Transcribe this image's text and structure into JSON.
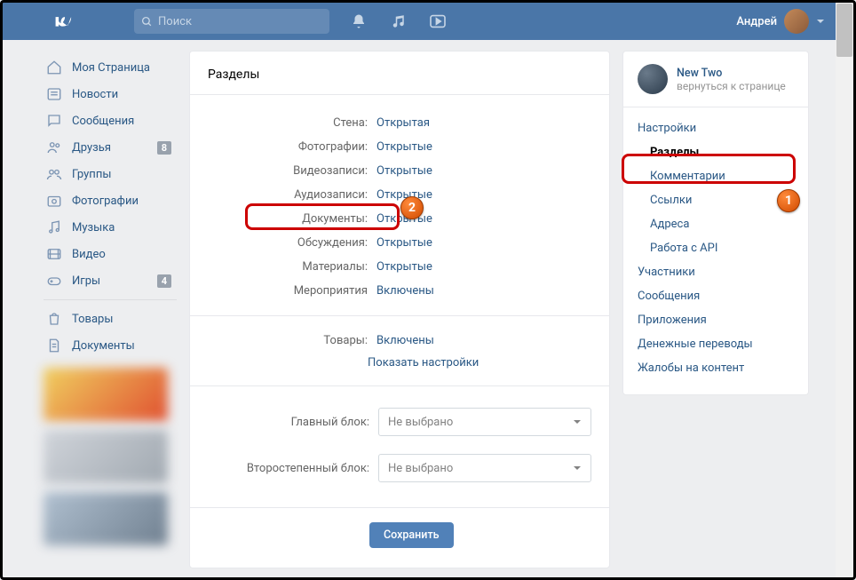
{
  "header": {
    "search_placeholder": "Поиск",
    "username": "Андрей"
  },
  "sidebar": {
    "items": [
      {
        "label": "Моя Страница",
        "icon": "home"
      },
      {
        "label": "Новости",
        "icon": "news"
      },
      {
        "label": "Сообщения",
        "icon": "msg"
      },
      {
        "label": "Друзья",
        "icon": "friends",
        "badge": "8"
      },
      {
        "label": "Группы",
        "icon": "groups"
      },
      {
        "label": "Фотографии",
        "icon": "photo"
      },
      {
        "label": "Музыка",
        "icon": "music"
      },
      {
        "label": "Видео",
        "icon": "video"
      },
      {
        "label": "Игры",
        "icon": "games",
        "badge": "4"
      }
    ],
    "extra": [
      {
        "label": "Товары",
        "icon": "shop"
      },
      {
        "label": "Документы",
        "icon": "docs"
      }
    ]
  },
  "main": {
    "title": "Разделы",
    "rows": [
      {
        "label": "Стена:",
        "value": "Открытая"
      },
      {
        "label": "Фотографии:",
        "value": "Открытые"
      },
      {
        "label": "Видеозаписи:",
        "value": "Открытые"
      },
      {
        "label": "Аудиозаписи:",
        "value": "Открытые"
      },
      {
        "label": "Документы:",
        "value": "Открытые"
      },
      {
        "label": "Обсуждения:",
        "value": "Открытые"
      },
      {
        "label": "Материалы:",
        "value": "Открытые"
      },
      {
        "label": "Мероприятия",
        "value": "Включены"
      }
    ],
    "goods": {
      "label": "Товары:",
      "value": "Включены"
    },
    "show_settings": "Показать настройки",
    "main_block": {
      "label": "Главный блок:",
      "value": "Не выбрано"
    },
    "secondary_block": {
      "label": "Второстепенный блок:",
      "value": "Не выбрано"
    },
    "save": "Сохранить"
  },
  "right": {
    "group_name": "New Two",
    "back": "вернуться к странице",
    "l1_1": "Настройки",
    "sections": "Разделы",
    "comments": "Комментарии",
    "links": "Ссылки",
    "addresses": "Адреса",
    "api": "Работа с API",
    "members": "Участники",
    "messages": "Сообщения",
    "apps": "Приложения",
    "money": "Денежные переводы",
    "complaints": "Жалобы на контент"
  },
  "callouts": {
    "c1": "1",
    "c2": "2"
  }
}
